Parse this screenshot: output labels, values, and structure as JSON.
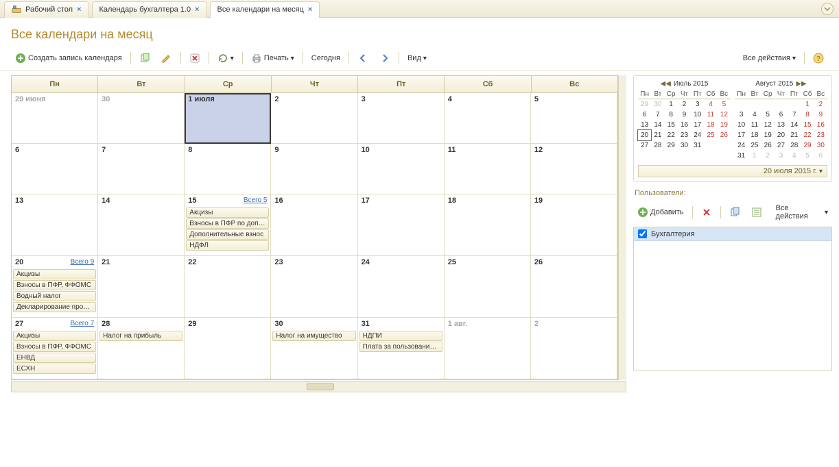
{
  "tabs": {
    "desktop": "Рабочий стол",
    "calapp": "Календарь бухгалтера 1.0",
    "month": "Все календари на месяц"
  },
  "title": "Все календари на месяц",
  "toolbar": {
    "create": "Создать запись календаря",
    "print": "Печать",
    "today": "Сегодня",
    "view": "Вид",
    "all_actions": "Все действия"
  },
  "week": {
    "mon": "Пн",
    "tue": "Вт",
    "wed": "Ср",
    "thu": "Чт",
    "fri": "Пт",
    "sat": "Сб",
    "sun": "Вс"
  },
  "cells": {
    "jun29": "29 июня",
    "d30": "30",
    "jul1": "1 июля",
    "d2": "2",
    "d3": "3",
    "d4": "4",
    "d5": "5",
    "d6": "6",
    "d7": "7",
    "d8": "8",
    "d9": "9",
    "d10": "10",
    "d11": "11",
    "d12": "12",
    "d13": "13",
    "d14": "14",
    "d15": "15",
    "d16": "16",
    "d17": "17",
    "d18": "18",
    "d19": "19",
    "d20": "20",
    "d21": "21",
    "d22": "22",
    "d23": "23",
    "d24": "24",
    "d25": "25",
    "d26": "26",
    "d27": "27",
    "d28": "28",
    "d29": "29",
    "d30b": "30",
    "d31": "31",
    "aug1": "1 авг.",
    "aug2": "2"
  },
  "totals": {
    "d15": "Всего 5",
    "d20": "Всего 9",
    "d27": "Всего 7"
  },
  "ev": {
    "d15": [
      "Акцизы",
      "Взносы в ПФР по допол",
      "Дополнительные взнос",
      "НДФЛ"
    ],
    "d20": [
      "Акцизы",
      "Взносы в ПФР, ФФОМС",
      "Водный налог",
      "Декларирование произв"
    ],
    "d27": [
      "Акцизы",
      "Взносы в ПФР, ФФОМС",
      "ЕНВД",
      "ЕСХН"
    ],
    "d28": [
      "Налог на прибыль"
    ],
    "d30": [
      "Налог на имущество"
    ],
    "d31": [
      "НДПИ",
      "Плата за пользование н"
    ]
  },
  "mini": {
    "july": {
      "title": "Июль 2015",
      "hdr": [
        "Пн",
        "Вт",
        "Ср",
        "Чт",
        "Пт",
        "Сб",
        "Вс"
      ],
      "rows": [
        [
          {
            "v": "29",
            "c": "oth"
          },
          {
            "v": "30",
            "c": "oth"
          },
          {
            "v": "1"
          },
          {
            "v": "2"
          },
          {
            "v": "3"
          },
          {
            "v": "4",
            "c": "wk"
          },
          {
            "v": "5",
            "c": "wk"
          }
        ],
        [
          {
            "v": "6"
          },
          {
            "v": "7"
          },
          {
            "v": "8"
          },
          {
            "v": "9"
          },
          {
            "v": "10"
          },
          {
            "v": "11",
            "c": "wk"
          },
          {
            "v": "12",
            "c": "wk"
          }
        ],
        [
          {
            "v": "13"
          },
          {
            "v": "14"
          },
          {
            "v": "15"
          },
          {
            "v": "16"
          },
          {
            "v": "17"
          },
          {
            "v": "18",
            "c": "wk"
          },
          {
            "v": "19",
            "c": "wk"
          }
        ],
        [
          {
            "v": "20",
            "c": "sel"
          },
          {
            "v": "21"
          },
          {
            "v": "22"
          },
          {
            "v": "23"
          },
          {
            "v": "24"
          },
          {
            "v": "25",
            "c": "wk"
          },
          {
            "v": "26",
            "c": "wk"
          }
        ],
        [
          {
            "v": "27"
          },
          {
            "v": "28"
          },
          {
            "v": "29"
          },
          {
            "v": "30"
          },
          {
            "v": "31"
          },
          {
            "v": "",
            "c": ""
          },
          {
            "v": "",
            "c": ""
          }
        ]
      ]
    },
    "aug": {
      "title": "Август 2015",
      "hdr": [
        "Пн",
        "Вт",
        "Ср",
        "Чт",
        "Пт",
        "Сб",
        "Вс"
      ],
      "rows": [
        [
          {
            "v": ""
          },
          {
            "v": ""
          },
          {
            "v": ""
          },
          {
            "v": ""
          },
          {
            "v": ""
          },
          {
            "v": "1",
            "c": "wk"
          },
          {
            "v": "2",
            "c": "wk"
          }
        ],
        [
          {
            "v": "3"
          },
          {
            "v": "4"
          },
          {
            "v": "5"
          },
          {
            "v": "6"
          },
          {
            "v": "7"
          },
          {
            "v": "8",
            "c": "wk"
          },
          {
            "v": "9",
            "c": "wk"
          }
        ],
        [
          {
            "v": "10"
          },
          {
            "v": "11"
          },
          {
            "v": "12"
          },
          {
            "v": "13"
          },
          {
            "v": "14"
          },
          {
            "v": "15",
            "c": "wk"
          },
          {
            "v": "16",
            "c": "wk"
          }
        ],
        [
          {
            "v": "17"
          },
          {
            "v": "18"
          },
          {
            "v": "19"
          },
          {
            "v": "20"
          },
          {
            "v": "21"
          },
          {
            "v": "22",
            "c": "wk"
          },
          {
            "v": "23",
            "c": "wk"
          }
        ],
        [
          {
            "v": "24"
          },
          {
            "v": "25"
          },
          {
            "v": "26"
          },
          {
            "v": "27"
          },
          {
            "v": "28"
          },
          {
            "v": "29",
            "c": "wk"
          },
          {
            "v": "30",
            "c": "wk"
          }
        ],
        [
          {
            "v": "31"
          },
          {
            "v": "1",
            "c": "oth"
          },
          {
            "v": "2",
            "c": "oth"
          },
          {
            "v": "3",
            "c": "oth"
          },
          {
            "v": "4",
            "c": "oth"
          },
          {
            "v": "5",
            "c": "oth"
          },
          {
            "v": "6",
            "c": "oth"
          }
        ]
      ]
    },
    "selected": "20 июля 2015 г."
  },
  "users": {
    "label": "Пользователи:",
    "add": "Добавить",
    "all_actions": "Все действия",
    "items": [
      "Бухгалтерия"
    ]
  }
}
